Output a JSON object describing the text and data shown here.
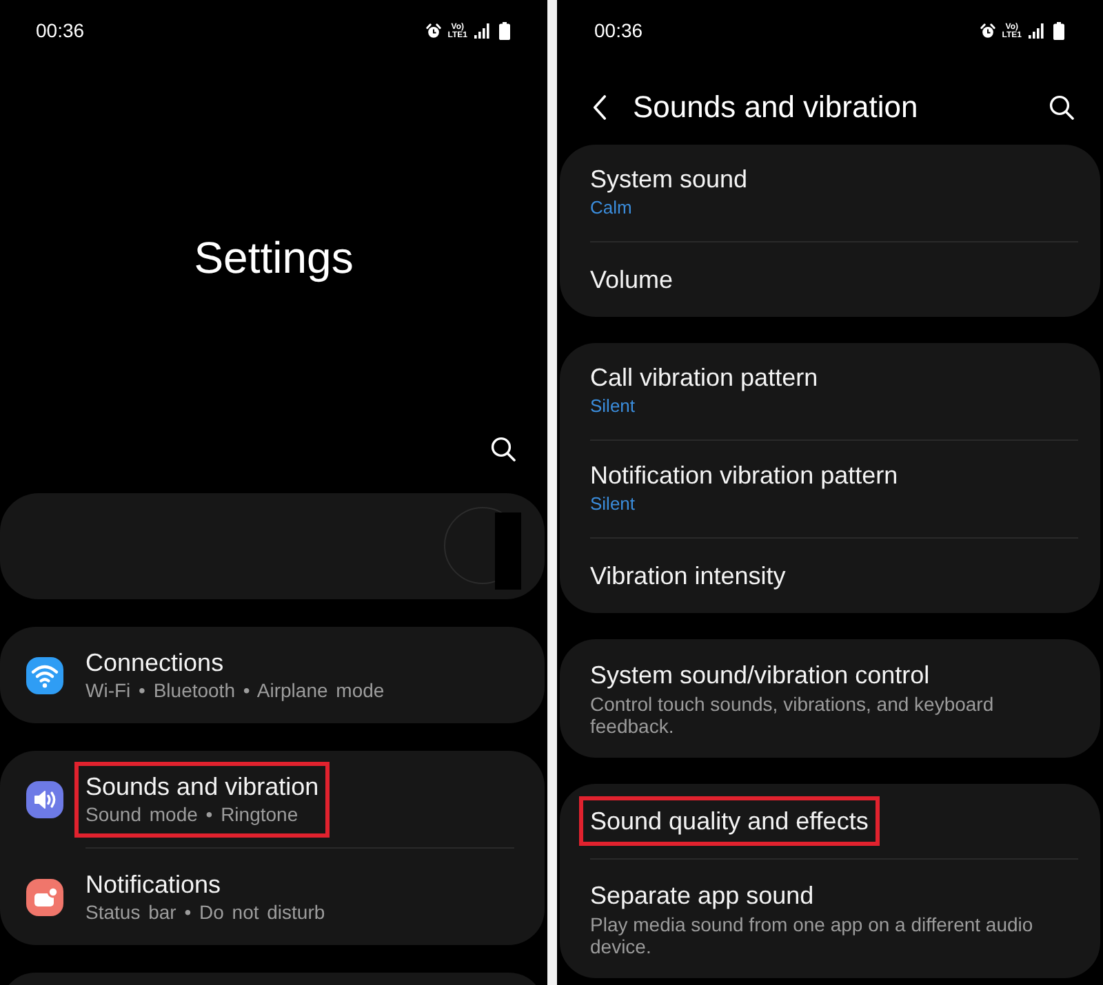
{
  "left_screen": {
    "status_bar": {
      "time": "00:36",
      "network_top": "Vo)",
      "network_bottom": "LTE1"
    },
    "title": "Settings",
    "groups": [
      {
        "items": [
          {
            "title": "Connections",
            "subtitle": "Wi-Fi • Bluetooth • Airplane mode",
            "color": "#2f9df4",
            "highlighted": false
          }
        ]
      },
      {
        "items": [
          {
            "title": "Sounds and vibration",
            "subtitle": "Sound mode • Ringtone",
            "color": "#6d7ae6",
            "highlighted": true
          },
          {
            "title": "Notifications",
            "subtitle": "Status bar • Do not disturb",
            "color": "#f0766b",
            "highlighted": false
          }
        ]
      }
    ]
  },
  "right_screen": {
    "status_bar": {
      "time": "00:36",
      "network_top": "Vo)",
      "network_bottom": "LTE1"
    },
    "header": {
      "title": "Sounds and vibration"
    },
    "groups": [
      {
        "items": [
          {
            "title": "System sound",
            "value": "Calm",
            "highlighted": false
          },
          {
            "title": "Volume",
            "highlighted": false
          }
        ]
      },
      {
        "items": [
          {
            "title": "Call vibration pattern",
            "value": "Silent",
            "highlighted": false
          },
          {
            "title": "Notification vibration pattern",
            "value": "Silent",
            "highlighted": false
          },
          {
            "title": "Vibration intensity",
            "highlighted": false
          }
        ]
      },
      {
        "items": [
          {
            "title": "System sound/vibration control",
            "description": "Control touch sounds, vibrations, and keyboard feedback.",
            "highlighted": false
          }
        ]
      },
      {
        "items": [
          {
            "title": "Sound quality and effects",
            "highlighted": true
          },
          {
            "title": "Separate app sound",
            "description": "Play media sound from one app on a different audio device.",
            "highlighted": false
          }
        ]
      }
    ]
  }
}
